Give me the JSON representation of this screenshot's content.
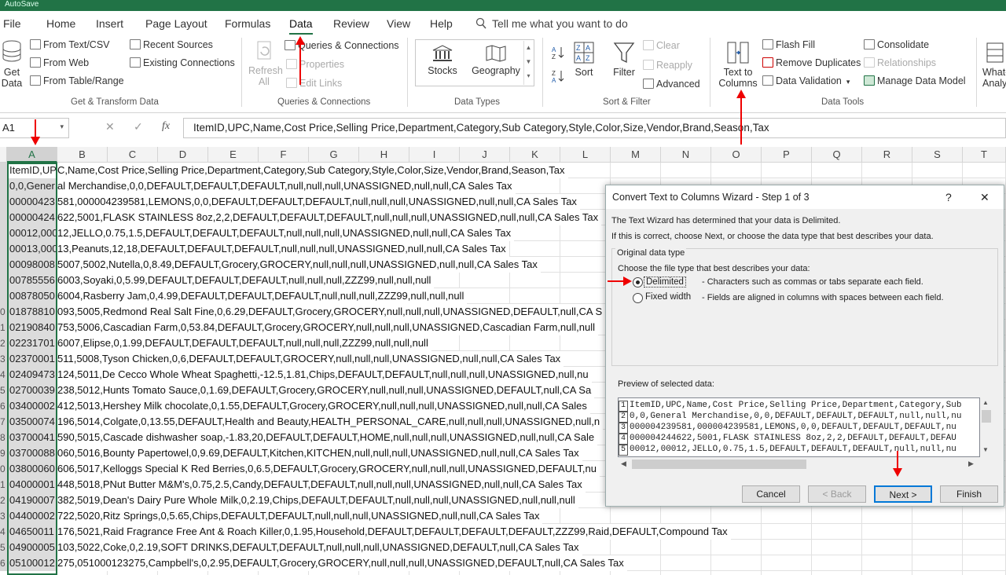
{
  "titlebar": {
    "text": "AutoSave"
  },
  "tabs": [
    "File",
    "Home",
    "Insert",
    "Page Layout",
    "Formulas",
    "Data",
    "Review",
    "View",
    "Help"
  ],
  "tell_me": "Tell me what you want to do",
  "ribbon": {
    "get_transform": {
      "get_data": "Get",
      "get_data2": "Data",
      "from_text": "From Text/CSV",
      "from_web": "From Web",
      "from_table": "From Table/Range",
      "recent": "Recent Sources",
      "existing": "Existing Connections",
      "label": "Get & Transform Data"
    },
    "queries": {
      "refresh": "Refresh",
      "refresh2": "All",
      "queries": "Queries & Connections",
      "properties": "Properties",
      "edit_links": "Edit Links",
      "label": "Queries & Connections"
    },
    "data_types": {
      "stocks": "Stocks",
      "geography": "Geography",
      "label": "Data Types"
    },
    "sort_filter": {
      "sort": "Sort",
      "filter": "Filter",
      "clear": "Clear",
      "reapply": "Reapply",
      "advanced": "Advanced",
      "label": "Sort & Filter"
    },
    "data_tools": {
      "text_to": "Text to",
      "columns": "Columns",
      "flash_fill": "Flash Fill",
      "remove_dup": "Remove Duplicates",
      "validation": "Data Validation",
      "consolidate": "Consolidate",
      "relationships": "Relationships",
      "manage_model": "Manage Data Model",
      "label": "Data Tools"
    },
    "whatif": {
      "l1": "What-",
      "l2": "Analy"
    }
  },
  "formula_bar": {
    "name_box": "A1",
    "formula": "ItemID,UPC,Name,Cost Price,Selling Price,Department,Category,Sub Category,Style,Color,Size,Vendor,Brand,Season,Tax"
  },
  "columns": [
    "A",
    "B",
    "C",
    "D",
    "E",
    "F",
    "G",
    "H",
    "I",
    "J",
    "K",
    "L",
    "M",
    "N",
    "O",
    "P",
    "Q",
    "R",
    "S",
    "T"
  ],
  "rows": [
    {
      "n": "",
      "a": "ItemID,UP",
      "rest": "C,Name,Cost Price,Selling Price,Department,Category,Sub Category,Style,Color,Size,Vendor,Brand,Season,Tax"
    },
    {
      "n": "",
      "a": "0,0,Gener",
      "rest": "al Merchandise,0,0,DEFAULT,DEFAULT,DEFAULT,null,null,null,UNASSIGNED,null,null,CA Sales Tax"
    },
    {
      "n": "",
      "a": "00000423",
      "rest": "581,000004239581,LEMONS,0,0,DEFAULT,DEFAULT,DEFAULT,null,null,null,UNASSIGNED,null,null,CA Sales Tax"
    },
    {
      "n": "",
      "a": "00000424",
      "rest": "622,5001,FLASK STAINLESS 8oz,2,2,DEFAULT,DEFAULT,DEFAULT,null,null,null,UNASSIGNED,null,null,CA Sales Tax"
    },
    {
      "n": "",
      "a": "00012,000",
      "rest": "12,JELLO,0.75,1.5,DEFAULT,DEFAULT,DEFAULT,null,null,null,UNASSIGNED,null,null,CA Sales Tax"
    },
    {
      "n": "",
      "a": "00013,000",
      "rest": "13,Peanuts,12,18,DEFAULT,DEFAULT,DEFAULT,null,null,null,UNASSIGNED,null,null,CA Sales Tax"
    },
    {
      "n": "",
      "a": "00098008",
      "rest": "5007,5002,Nutella,0,8.49,DEFAULT,Grocery,GROCERY,null,null,null,UNASSIGNED,null,null,CA Sales Tax"
    },
    {
      "n": "",
      "a": "00785556",
      "rest": "6003,Soyaki,0,5.99,DEFAULT,DEFAULT,DEFAULT,null,null,null,ZZZ99,null,null,null"
    },
    {
      "n": "",
      "a": "00878050",
      "rest": "6004,Rasberry Jam,0,4.99,DEFAULT,DEFAULT,DEFAULT,null,null,null,ZZZ99,null,null,null"
    },
    {
      "n": "0",
      "a": "01878810",
      "rest": "093,5005,Redmond Real Salt Fine,0,6.29,DEFAULT,Grocery,GROCERY,null,null,null,UNASSIGNED,DEFAULT,null,CA S"
    },
    {
      "n": "1",
      "a": "02190840",
      "rest": "753,5006,Cascadian Farm,0,53.84,DEFAULT,Grocery,GROCERY,null,null,null,UNASSIGNED,Cascadian Farm,null,null"
    },
    {
      "n": "2",
      "a": "02231701",
      "rest": "6007,Elipse,0,1.99,DEFAULT,DEFAULT,DEFAULT,null,null,null,ZZZ99,null,null,null"
    },
    {
      "n": "3",
      "a": "02370001",
      "rest": "511,5008,Tyson Chicken,0,6,DEFAULT,DEFAULT,GROCERY,null,null,null,UNASSIGNED,null,null,CA Sales Tax"
    },
    {
      "n": "4",
      "a": "02409473",
      "rest": "124,5011,De Cecco Whole Wheat Spaghetti,-12.5,1.81,Chips,DEFAULT,DEFAULT,null,null,null,UNASSIGNED,null,nu"
    },
    {
      "n": "5",
      "a": "02700039",
      "rest": "238,5012,Hunts Tomato Sauce,0,1.69,DEFAULT,Grocery,GROCERY,null,null,null,UNASSIGNED,DEFAULT,null,CA Sa"
    },
    {
      "n": "6",
      "a": "03400002",
      "rest": "412,5013,Hershey Milk chocolate,0,1.55,DEFAULT,Grocery,GROCERY,null,null,null,UNASSIGNED,null,null,CA Sales"
    },
    {
      "n": "7",
      "a": "03500074",
      "rest": "196,5014,Colgate,0,13.55,DEFAULT,Health and Beauty,HEALTH_PERSONAL_CARE,null,null,null,UNASSIGNED,null,n"
    },
    {
      "n": "8",
      "a": "03700041",
      "rest": "590,5015,Cascade dishwasher soap,-1.83,20,DEFAULT,DEFAULT,HOME,null,null,null,UNASSIGNED,null,null,CA Sale"
    },
    {
      "n": "9",
      "a": "03700088",
      "rest": "060,5016,Bounty Papertowel,0,9.69,DEFAULT,Kitchen,KITCHEN,null,null,null,UNASSIGNED,null,null,CA Sales Tax"
    },
    {
      "n": "0",
      "a": "03800060",
      "rest": "606,5017,Kelloggs Special K Red Berries,0,6.5,DEFAULT,Grocery,GROCERY,null,null,null,UNASSIGNED,DEFAULT,nu"
    },
    {
      "n": "1",
      "a": "04000001",
      "rest": "448,5018,PNut Butter M&M's,0.75,2.5,Candy,DEFAULT,DEFAULT,null,null,null,UNASSIGNED,null,null,CA Sales Tax"
    },
    {
      "n": "2",
      "a": "04190007",
      "rest": "382,5019,Dean's Dairy Pure Whole Milk,0,2.19,Chips,DEFAULT,DEFAULT,null,null,null,UNASSIGNED,null,null,null"
    },
    {
      "n": "3",
      "a": "04400002",
      "rest": "722,5020,Ritz Springs,0,5.65,Chips,DEFAULT,DEFAULT,null,null,null,UNASSIGNED,null,null,CA Sales Tax"
    },
    {
      "n": "4",
      "a": "04650011",
      "rest": "176,5021,Raid Fragrance Free Ant & Roach Killer,0,1.95,Household,DEFAULT,DEFAULT,DEFAULT,DEFAULT,ZZZ99,Raid,DEFAULT,Compound Tax"
    },
    {
      "n": "5",
      "a": "04900005",
      "rest": "103,5022,Coke,0,2.19,SOFT DRINKS,DEFAULT,DEFAULT,null,null,null,UNASSIGNED,DEFAULT,null,CA Sales Tax"
    },
    {
      "n": "6",
      "a": "05100012",
      "rest": "275,051000123275,Campbell's,0,2.95,DEFAULT,Grocery,GROCERY,null,null,null,UNASSIGNED,DEFAULT,null,CA Sales Tax"
    }
  ],
  "dialog": {
    "title": "Convert Text to Columns Wizard - Step 1 of 3",
    "help": "?",
    "close": "✕",
    "intro1": "The Text Wizard has determined that your data is Delimited.",
    "intro2": "If this is correct, choose Next, or choose the data type that best describes your data.",
    "group": "Original data type",
    "choose": "Choose the file type that best describes your data:",
    "opt1": "Delimited",
    "opt1_desc": "- Characters such as commas or tabs separate each field.",
    "opt2": "Fixed width",
    "opt2_desc": "- Fields are aligned in columns with spaces between each field.",
    "preview_label": "Preview of selected data:",
    "preview": [
      {
        "n": "1",
        "t": "ItemID,UPC,Name,Cost Price,Selling Price,Department,Category,Sub"
      },
      {
        "n": "2",
        "t": "0,0,General Merchandise,0,0,DEFAULT,DEFAULT,DEFAULT,null,null,nu"
      },
      {
        "n": "3",
        "t": "000004239581,000004239581,LEMONS,0,0,DEFAULT,DEFAULT,DEFAULT,nu"
      },
      {
        "n": "4",
        "t": "000004244622,5001,FLASK STAINLESS 8oz,2,2,DEFAULT,DEFAULT,DEFAU"
      },
      {
        "n": "5",
        "t": "00012,00012,JELLO,0.75,1.5,DEFAULT,DEFAULT,DEFAULT,null,null,nu"
      }
    ],
    "cancel": "Cancel",
    "back": "< Back",
    "next": "Next >",
    "finish": "Finish"
  },
  "accent": "#217346",
  "annotation_color": "#e00000"
}
